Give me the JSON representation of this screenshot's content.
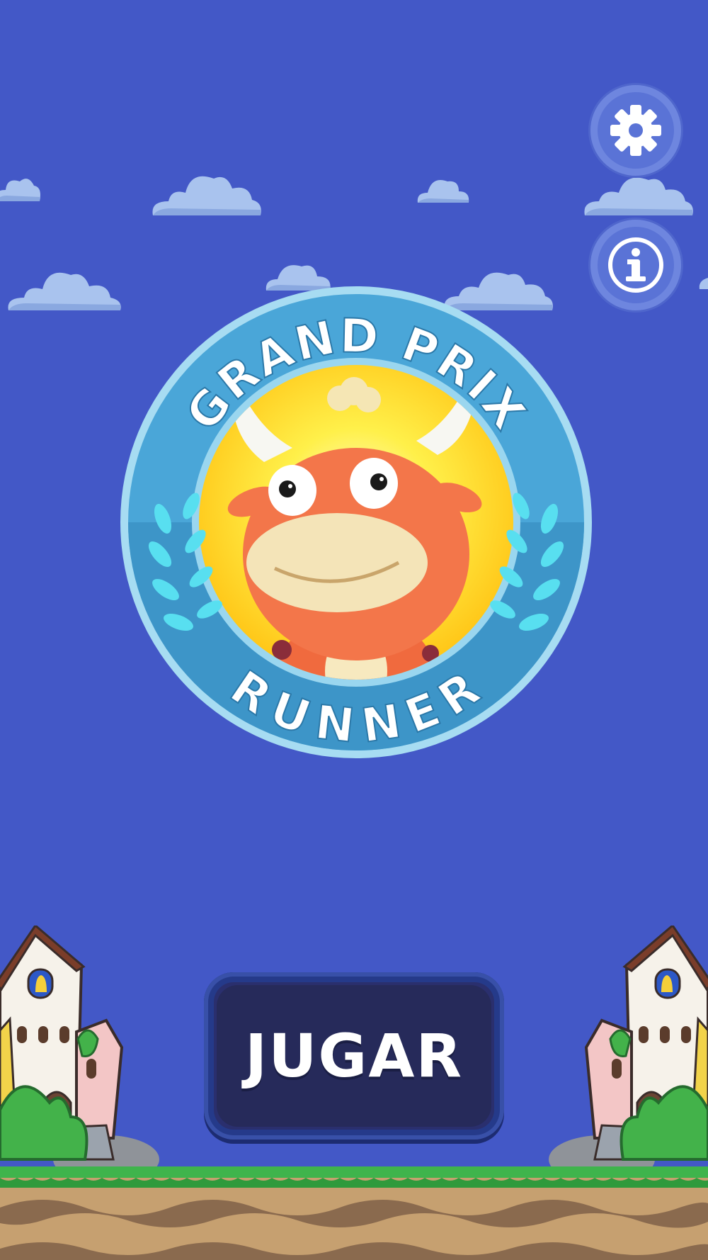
{
  "game": {
    "logo": {
      "title_top": "GRAND PRIX",
      "title_bottom": "RUNNER"
    },
    "settings_button": {
      "icon": "gear-icon"
    },
    "info_button": {
      "icon": "info-icon"
    },
    "play_button": {
      "label": "JUGAR"
    }
  },
  "colors": {
    "sky": "#4358c7",
    "badge_ring": "#4ba6d8",
    "badge_center": "#ffe23a",
    "button_face": "#262a5a",
    "grass": "#3fb44c",
    "dirt": "#c6a070"
  }
}
